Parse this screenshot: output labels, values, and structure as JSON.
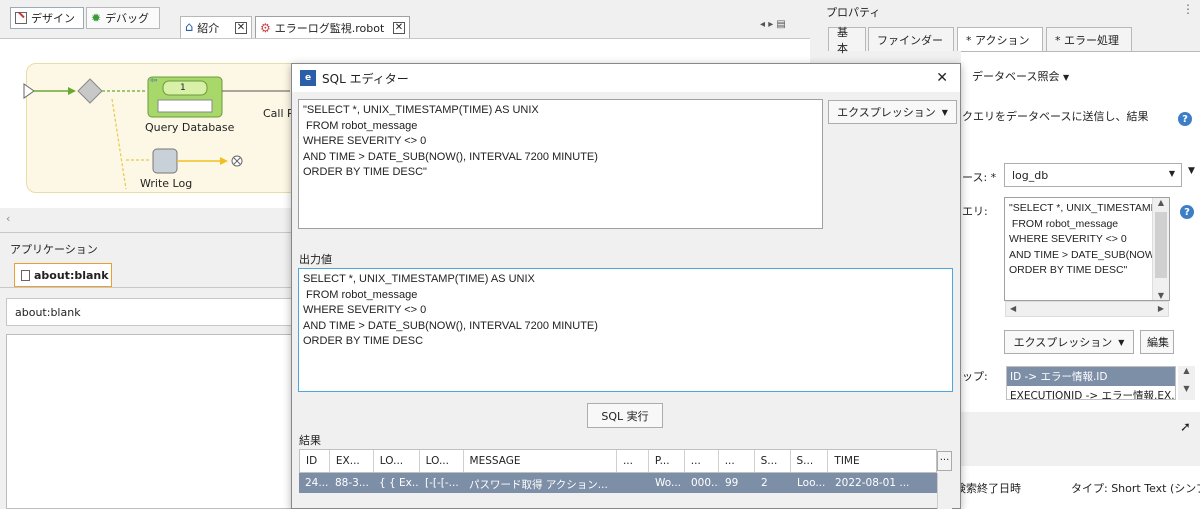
{
  "toolbar": {
    "design_label": "デザイン",
    "debug_label": "デバッグ"
  },
  "editor_tabs": [
    {
      "label": "紹介",
      "close": "✕"
    },
    {
      "label": "エラーログ監視.robot",
      "close": "✕"
    }
  ],
  "flow": {
    "query_node_label": "Query Database",
    "query_node_badge": "1",
    "write_log_label": "Write Log",
    "call_label": "Call R"
  },
  "application": {
    "title": "アプリケーション",
    "tab_label": "about:blank",
    "url_value": "about:blank"
  },
  "dialog": {
    "title": "SQL エディター",
    "close": "✕",
    "expression_button": "エクスプレッション",
    "sql_input": "\"SELECT *, UNIX_TIMESTAMP(TIME) AS UNIX\n FROM robot_message\nWHERE SEVERITY <> 0\nAND TIME > DATE_SUB(NOW(), INTERVAL 7200 MINUTE)\nORDER BY TIME DESC\"",
    "output_label": "出力値",
    "output_value": "SELECT *, UNIX_TIMESTAMP(TIME) AS UNIX\n FROM robot_message\nWHERE SEVERITY <> 0\nAND TIME > DATE_SUB(NOW(), INTERVAL 7200 MINUTE)\nORDER BY TIME DESC",
    "run_button": "SQL 実行",
    "results_label": "結果",
    "result_columns": [
      "ID",
      "EX...",
      "LO...",
      "LO...",
      "MESSAGE",
      "...",
      "P...",
      "...",
      "...",
      "S...",
      "S...",
      "TIME",
      "..."
    ],
    "result_rows": [
      [
        "24...",
        "88-3...",
        "{ { Ex...",
        "[-[-[-...",
        "パスワード取得 アクション...",
        "",
        "Wo...",
        "000...",
        "99",
        "2",
        "Loo...",
        "2022-08-01 ..."
      ]
    ]
  },
  "properties": {
    "title": "プロパティ",
    "tabs": [
      "基本",
      "ファインダー",
      "* アクション",
      "* エラー処理"
    ],
    "action_dropdown": "データベース照会",
    "description": "クエリをデータベースに送信し、結果",
    "db_label": "ース: *",
    "db_value": "log_db",
    "query_label": "エリ:",
    "query_value": "\"SELECT *, UNIX_TIMESTAMP\n FROM robot_message\nWHERE SEVERITY <> 0\nAND TIME > DATE_SUB(NOW\nORDER BY TIME DESC\"",
    "expression_button": "エクスプレッション",
    "edit_button": "編集",
    "map_label": "ップ:",
    "map_items": [
      "ID -> エラー情報.ID",
      "EXECUTIONID -> エラー情報.EX..."
    ],
    "footer_left": "検索終了日時",
    "footer_right": "タイプ: Short Text (シンプ"
  },
  "colors": {
    "accent": "#4da6e0",
    "node_green": "#a8d86a",
    "selected_row": "#7d8ea7"
  }
}
